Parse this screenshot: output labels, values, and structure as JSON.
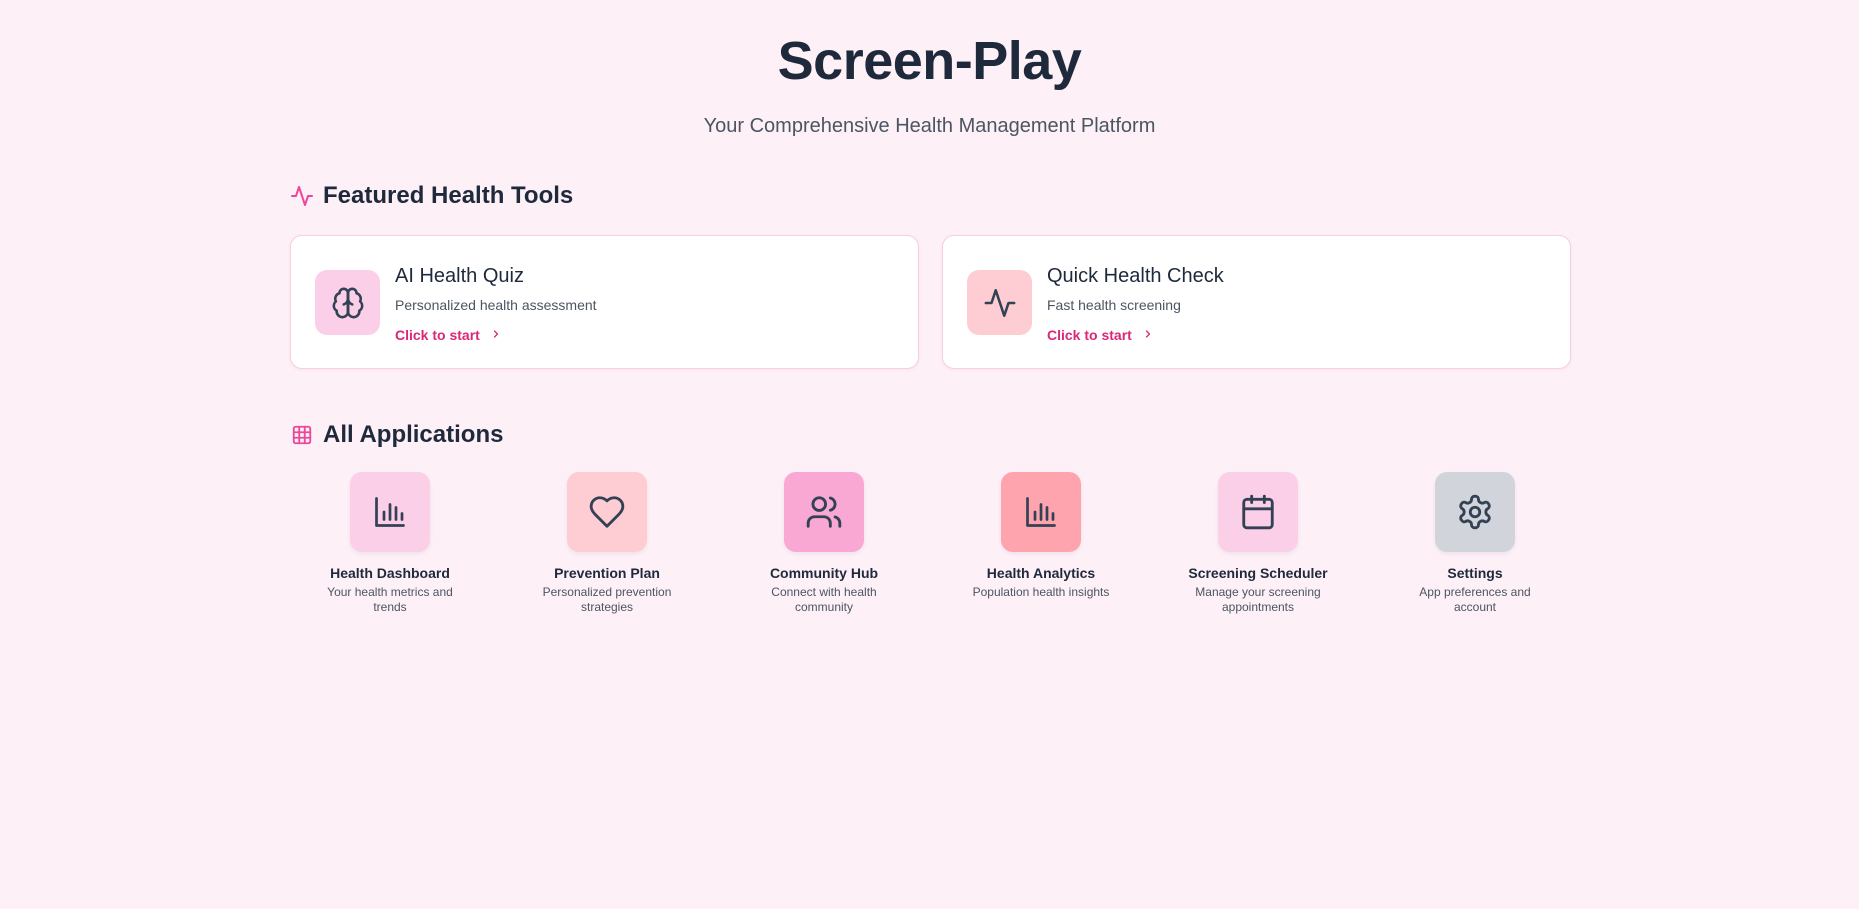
{
  "hero": {
    "title": "Screen-Play",
    "subtitle": "Your Comprehensive Health Management Platform"
  },
  "featured": {
    "heading": "Featured Health Tools",
    "heading_icon": "activity-icon",
    "cards": [
      {
        "title": "AI Health Quiz",
        "subtitle": "Personalized health assessment",
        "cta": "Click to start",
        "icon": "brain-icon",
        "color": "#fbcfe8"
      },
      {
        "title": "Quick Health Check",
        "subtitle": "Fast health screening",
        "cta": "Click to start",
        "icon": "activity-icon",
        "color": "#fecdd3"
      }
    ]
  },
  "apps": {
    "heading": "All Applications",
    "heading_icon": "grid-icon",
    "items": [
      {
        "title": "Health Dashboard",
        "subtitle": "Your health metrics and trends",
        "icon": "bar-chart-icon",
        "color": "#fbcfe8"
      },
      {
        "title": "Prevention Plan",
        "subtitle": "Personalized prevention strategies",
        "icon": "heart-icon",
        "color": "#fecdd3"
      },
      {
        "title": "Community Hub",
        "subtitle": "Connect with health community",
        "icon": "users-icon",
        "color": "#f9a8d4"
      },
      {
        "title": "Health Analytics",
        "subtitle": "Population health insights",
        "icon": "bar-chart-icon",
        "color": "#fda4af"
      },
      {
        "title": "Screening Scheduler",
        "subtitle": "Manage your screening appointments",
        "icon": "calendar-icon",
        "color": "#fbcfe8"
      },
      {
        "title": "Settings",
        "subtitle": "App preferences and account",
        "icon": "gear-icon",
        "color": "#d1d5db"
      }
    ]
  },
  "colors": {
    "background": "#fdf0f6",
    "accent": "#db2777",
    "text": "#1e293b"
  }
}
